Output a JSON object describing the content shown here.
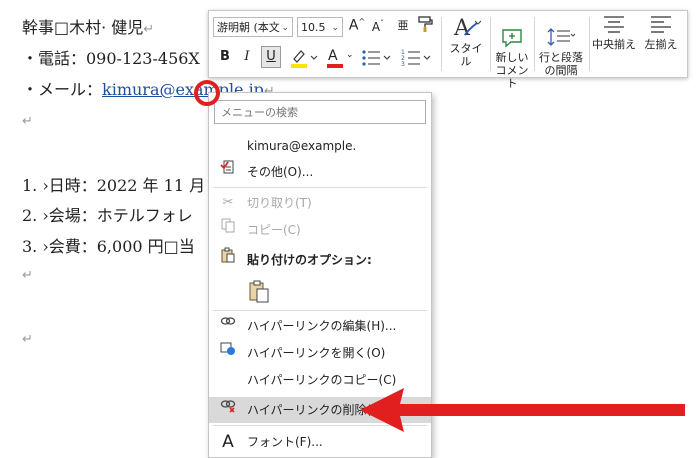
{
  "document": {
    "line1": "幹事□木村· 健児",
    "line2": "・電話：090-123-456X",
    "line3_prefix": "・メール：",
    "line3_link": "kimura@example.jp",
    "line5": "1.  ›日時：2022 年 11 月",
    "line6": "2.  ›会場：ホテルフォレ",
    "line7": "3.  ›会費：6,000 円□当",
    "para_mark": "↵"
  },
  "mini_toolbar": {
    "font_name": "游明朝 (本文",
    "font_size": "10.5",
    "grow_font": "A",
    "shrink_font": "A",
    "phonetic": "亜",
    "bold": "B",
    "italic": "I",
    "underline": "U",
    "font_color_letter": "A",
    "styles_label": "スタイル",
    "new_comment_label": "新しい\nコメント",
    "line_spacing_label": "行と段落\nの間隔",
    "center_label": "中央揃え",
    "left_label": "左揃え"
  },
  "context_menu": {
    "search_placeholder": "メニューの検索",
    "items": [
      {
        "label": "kimura@example.",
        "icon": "",
        "disabled": false
      },
      {
        "label": "その他(O)...",
        "icon": "more-icon",
        "disabled": false
      },
      {
        "label": "切り取り(T)",
        "icon": "scissors-icon",
        "disabled": true
      },
      {
        "label": "コピー(C)",
        "icon": "copy-icon",
        "disabled": true
      },
      {
        "label": "貼り付けのオプション:",
        "icon": "paste-icon",
        "disabled": false
      },
      {
        "label": "ハイパーリンクの編集(H)...",
        "icon": "link-edit-icon",
        "disabled": false
      },
      {
        "label": "ハイパーリンクを開く(O)",
        "icon": "link-open-icon",
        "disabled": false
      },
      {
        "label": "ハイパーリンクのコピー(C)",
        "icon": "",
        "disabled": false
      },
      {
        "label": "ハイパーリンクの削除(R)",
        "icon": "link-remove-icon",
        "disabled": false,
        "highlighted": true
      },
      {
        "label": "フォント(F)...",
        "icon": "font-icon",
        "disabled": false
      }
    ]
  },
  "colors": {
    "accent_red": "#e21f1f",
    "link_blue": "#1f4e9b",
    "highlight_yellow": "#ffe400",
    "font_red": "#e21f1f"
  }
}
